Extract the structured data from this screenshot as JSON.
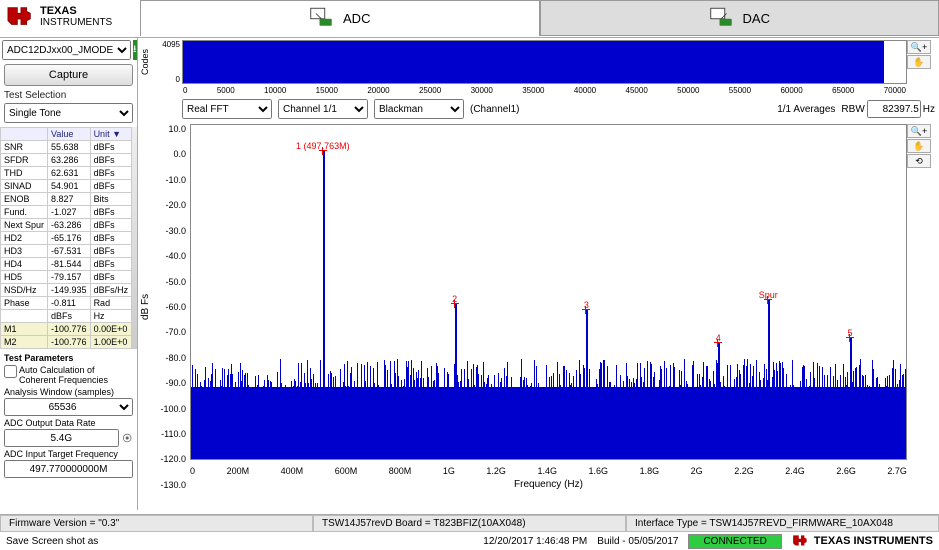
{
  "logo": {
    "line1": "TEXAS",
    "line2": "INSTRUMENTS"
  },
  "tabs": {
    "adc": "ADC",
    "dac": "DAC"
  },
  "sidebar": {
    "deviceOptions": [
      "ADC12DJxx00_JMODE"
    ],
    "captureLabel": "Capture",
    "testSelectionLabel": "Test Selection",
    "testOptions": [
      "Single Tone"
    ],
    "headers": {
      "blank": "",
      "value": "Value",
      "unit": "Unit ▼"
    },
    "metrics": [
      {
        "name": "SNR",
        "value": "55.638",
        "unit": "dBFs"
      },
      {
        "name": "SFDR",
        "value": "63.286",
        "unit": "dBFs"
      },
      {
        "name": "THD",
        "value": "62.631",
        "unit": "dBFs"
      },
      {
        "name": "SINAD",
        "value": "54.901",
        "unit": "dBFs"
      },
      {
        "name": "ENOB",
        "value": "8.827",
        "unit": "Bits"
      },
      {
        "name": "Fund.",
        "value": "-1.027",
        "unit": "dBFs"
      },
      {
        "name": "Next Spur",
        "value": "-63.286",
        "unit": "dBFs"
      },
      {
        "name": "HD2",
        "value": "-65.176",
        "unit": "dBFs"
      },
      {
        "name": "HD3",
        "value": "-67.531",
        "unit": "dBFs"
      },
      {
        "name": "HD4",
        "value": "-81.544",
        "unit": "dBFs"
      },
      {
        "name": "HD5",
        "value": "-79.157",
        "unit": "dBFs"
      },
      {
        "name": "NSD/Hz",
        "value": "-149.935",
        "unit": "dBFs/Hz"
      },
      {
        "name": "Phase",
        "value": "-0.811",
        "unit": "Rad"
      },
      {
        "name": "",
        "value": "dBFs",
        "unit": "Hz"
      },
      {
        "name": "M1",
        "value": "-100.776",
        "unit": "0.00E+0"
      },
      {
        "name": "M2",
        "value": "-100.776",
        "unit": "1.00E+0"
      }
    ],
    "paramsTitle": "Test Parameters",
    "autoCalc": "Auto Calculation of Coherent Frequencies",
    "analysisWinLabel": "Analysis Window (samples)",
    "analysisWin": "65536",
    "adcRateLabel": "ADC Output Data Rate",
    "adcRate": "5.4G",
    "adcTargetLabel": "ADC Input Target Frequency",
    "adcTarget": "497.770000000M"
  },
  "codes": {
    "ylabel": "Codes",
    "ymax": "4095",
    "ymin": "0",
    "xticks": [
      "0",
      "5000",
      "10000",
      "15000",
      "20000",
      "25000",
      "30000",
      "35000",
      "40000",
      "45000",
      "50000",
      "55000",
      "60000",
      "65000",
      "70000"
    ]
  },
  "controls": {
    "fftType": "Real FFT",
    "channel": "Channel 1/1",
    "window": "Blackman",
    "channelLabel": "(Channel1)",
    "averages": "1/1 Averages",
    "rbwLabel": "RBW",
    "rbwValue": "82397.5",
    "rbwUnit": "Hz"
  },
  "fft": {
    "ylabel": "dB Fs",
    "yticks": [
      "10.0",
      "0.0",
      "-10.0",
      "-20.0",
      "-30.0",
      "-40.0",
      "-50.0",
      "-60.0",
      "-70.0",
      "-80.0",
      "-90.0",
      "-100.0",
      "-110.0",
      "-120.0",
      "-130.0"
    ],
    "xticks": [
      "0",
      "200M",
      "400M",
      "600M",
      "800M",
      "1G",
      "1.2G",
      "1.4G",
      "1.6G",
      "1.8G",
      "2G",
      "2.2G",
      "2.4G",
      "2.6G",
      "2.7G"
    ],
    "xlabel": "Frequency (Hz)"
  },
  "chart_data": {
    "type": "line",
    "title": "FFT Spectrum",
    "xlabel": "Frequency (Hz)",
    "ylabel": "dB Fs",
    "xlim": [
      0,
      2700000000.0
    ],
    "ylim": [
      -130,
      10
    ],
    "noise_floor_dbfs": -100,
    "fundamental": {
      "freq_hz": 497763000,
      "level_dbfs": -1.027,
      "label": "1 (497.763M)"
    },
    "harmonics": [
      {
        "n": 2,
        "freq_hz": 995526000,
        "level_dbfs": -65.176
      },
      {
        "n": 3,
        "freq_hz": 1493289000,
        "level_dbfs": -67.531
      },
      {
        "n": 4,
        "freq_hz": 1991052000,
        "level_dbfs": -81.544
      },
      {
        "n": 5,
        "freq_hz": 2488815000,
        "level_dbfs": -79.157
      }
    ],
    "spur": {
      "freq_hz": 2180000000.0,
      "level_dbfs": -63.286,
      "label": "Spur"
    }
  },
  "footer": {
    "firmware": "Firmware Version = \"0.3\"",
    "board": "TSW14J57revD Board = T823BFIZ(10AX048)",
    "iface": "Interface Type = TSW14J57REVD_FIRMWARE_10AX048",
    "save": "Save Screen shot as",
    "timestamp": "12/20/2017 1:46:48 PM",
    "build": "Build - 05/05/2017",
    "connected": "CONNECTED"
  }
}
